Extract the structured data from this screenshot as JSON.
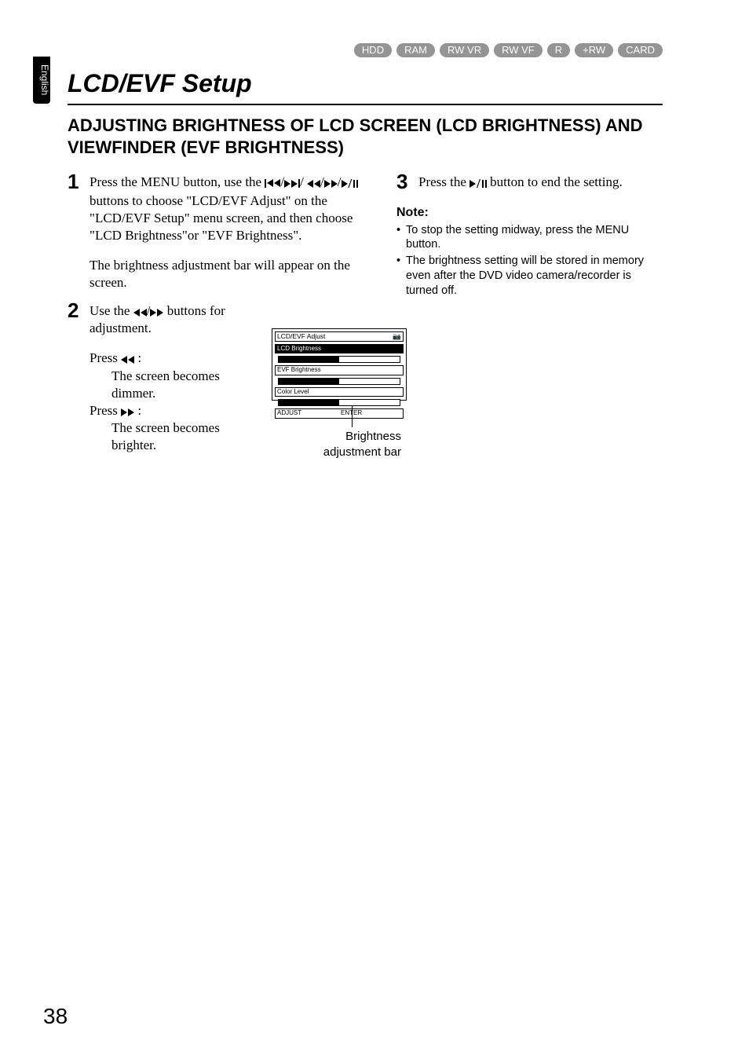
{
  "side_tab": "English",
  "badges": [
    "HDD",
    "RAM",
    "RW VR",
    "RW VF",
    "R",
    "+RW",
    "CARD"
  ],
  "title": "LCD/EVF Setup",
  "section": "ADJUSTING BRIGHTNESS OF LCD SCREEN (LCD BRIGHTNESS) AND VIEWFINDER (EVF BRIGHTNESS)",
  "icons": {
    "skipb": "skipb-icon",
    "skipf": "skipf-icon",
    "frew": "frew-icon",
    "ffwd": "ffwd-icon",
    "playpause": "playpause-icon"
  },
  "step1": {
    "num": "1",
    "a": "Press the MENU button, use the ",
    "b": " buttons to choose \"LCD/EVF Adjust\" on the \"LCD/EVF Setup\" menu screen, and then choose \"LCD Brightness\"or \"EVF Brightness\".",
    "c": "The brightness adjustment bar will appear on the screen."
  },
  "step2": {
    "num": "2",
    "a": "Use the ",
    "b": " buttons for adjustment.",
    "press_l": "Press ",
    "dimmer": "The screen becomes dimmer.",
    "press_r": "Press ",
    "brighter": "The screen becomes brighter."
  },
  "step3": {
    "num": "3",
    "a": "Press the ",
    "b": " button to end the setting."
  },
  "note_head": "Note:",
  "notes": [
    "To stop the setting midway, press the MENU button.",
    "The brightness setting will be stored in memory even after the DVD video camera/recorder is turned off."
  ],
  "figure": {
    "title": "LCD/EVF Adjust",
    "row1": "LCD Brightness",
    "row2": "EVF Brightness",
    "row3": "Color Level",
    "foot_l": "ADJUST",
    "foot_c": "ENTER",
    "caption1": "Brightness",
    "caption2": "adjustment bar"
  },
  "pagenum": "38"
}
